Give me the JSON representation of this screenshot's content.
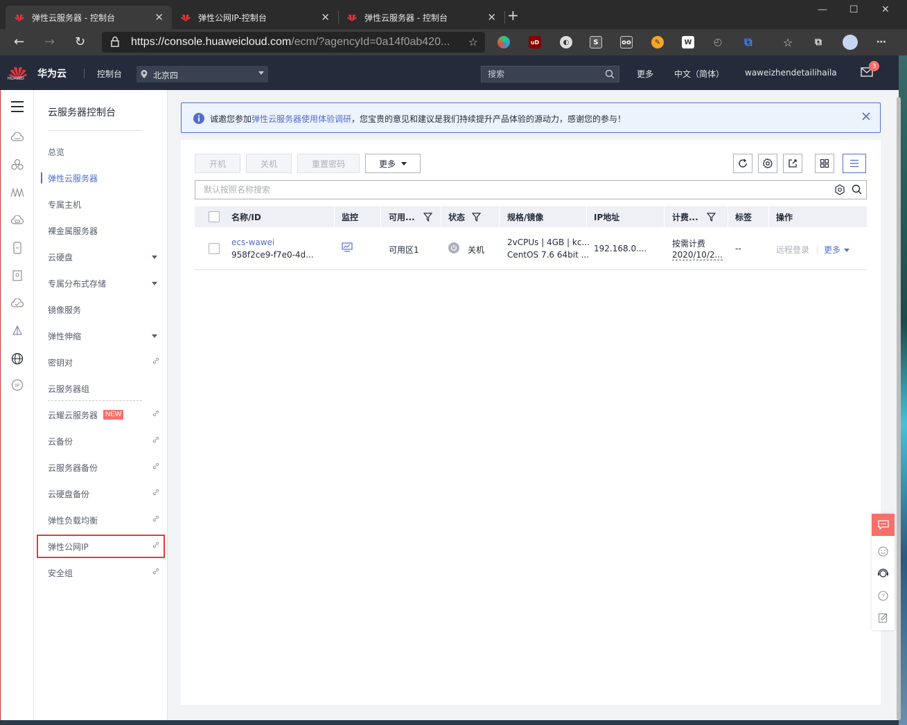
{
  "browser": {
    "tabs": [
      {
        "title": "弹性云服务器 - 控制台",
        "active": true
      },
      {
        "title": "弹性公网IP-控制台",
        "active": false
      },
      {
        "title": "弹性云服务器 - 控制台",
        "active": false
      }
    ],
    "url_host": "https://console.huaweicloud.com",
    "url_path": "/ecm/?agencyId=0a14f0ab420...",
    "extensions": [
      "color-picker-icon",
      "ublock-icon",
      "privacy-icon",
      "s-icon",
      "mask-icon",
      "kiwi-icon",
      "w-icon",
      "clock-icon",
      "crop-icon",
      "favorites-icon",
      "collections-icon",
      "profile-avatar",
      "menu-icon"
    ],
    "ext_labels": {
      "ublock": "uD",
      "s": "S",
      "w": "W"
    }
  },
  "header": {
    "logo_text": "HUAWEI",
    "brand": "华为云",
    "console": "控制台",
    "region": "北京四",
    "search_placeholder": "搜索",
    "more": "更多",
    "language": "中文（简体）",
    "username": "waweizhendetailihaila",
    "mail_count": "3"
  },
  "sidebar": {
    "title": "云服务器控制台",
    "items": [
      {
        "label": "总览"
      },
      {
        "label": "弹性云服务器",
        "active": true
      },
      {
        "label": "专属主机"
      },
      {
        "label": "裸金属服务器"
      },
      {
        "label": "云硬盘",
        "expandable": true
      },
      {
        "label": "专属分布式存储",
        "expandable": true
      },
      {
        "label": "镜像服务"
      },
      {
        "label": "弹性伸缩",
        "expandable": true
      },
      {
        "label": "密钥对",
        "external": true
      },
      {
        "label": "云服务器组"
      },
      {
        "label": "云耀云服务器",
        "badge": "NEW",
        "external": true
      },
      {
        "label": "云备份",
        "external": true
      },
      {
        "label": "云服务器备份",
        "external": true
      },
      {
        "label": "云硬盘备份",
        "external": true
      },
      {
        "label": "弹性负载均衡",
        "external": true
      },
      {
        "label": "弹性公网IP",
        "external": true,
        "highlighted": true
      },
      {
        "label": "安全组",
        "external": true
      }
    ]
  },
  "notice": {
    "prefix": "诚邀您参加",
    "link": "弹性云服务器使用体验调研",
    "suffix": "，您宝贵的意见和建议是我们持续提升产品体验的源动力，感谢您的参与！"
  },
  "toolbar": {
    "start": "开机",
    "stop": "关机",
    "reset_password": "重置密码",
    "more": "更多"
  },
  "filter": {
    "placeholder": "默认按照名称搜索"
  },
  "table": {
    "columns": [
      "名称/ID",
      "监控",
      "可用...",
      "状态",
      "规格/镜像",
      "IP地址",
      "计费...",
      "标签",
      "操作"
    ],
    "rows": [
      {
        "name": "ecs-wawei",
        "id": "958f2ce9-f7e0-4d...",
        "zone": "可用区1",
        "status": "关机",
        "spec": "2vCPUs | 4GB | kc...",
        "image": "CentOS 7.6 64bit ...",
        "ip": "192.168.0....",
        "billing": "按需计费",
        "billing_date": "2020/10/2...",
        "tags": "--",
        "action_remote": "远程登录",
        "action_more": "更多"
      }
    ]
  },
  "colors": {
    "accent": "#526ecc",
    "brand_red": "#c7000b",
    "header_bg": "#252b3a",
    "highlight": "#e53935",
    "badge": "#f66f6a"
  }
}
